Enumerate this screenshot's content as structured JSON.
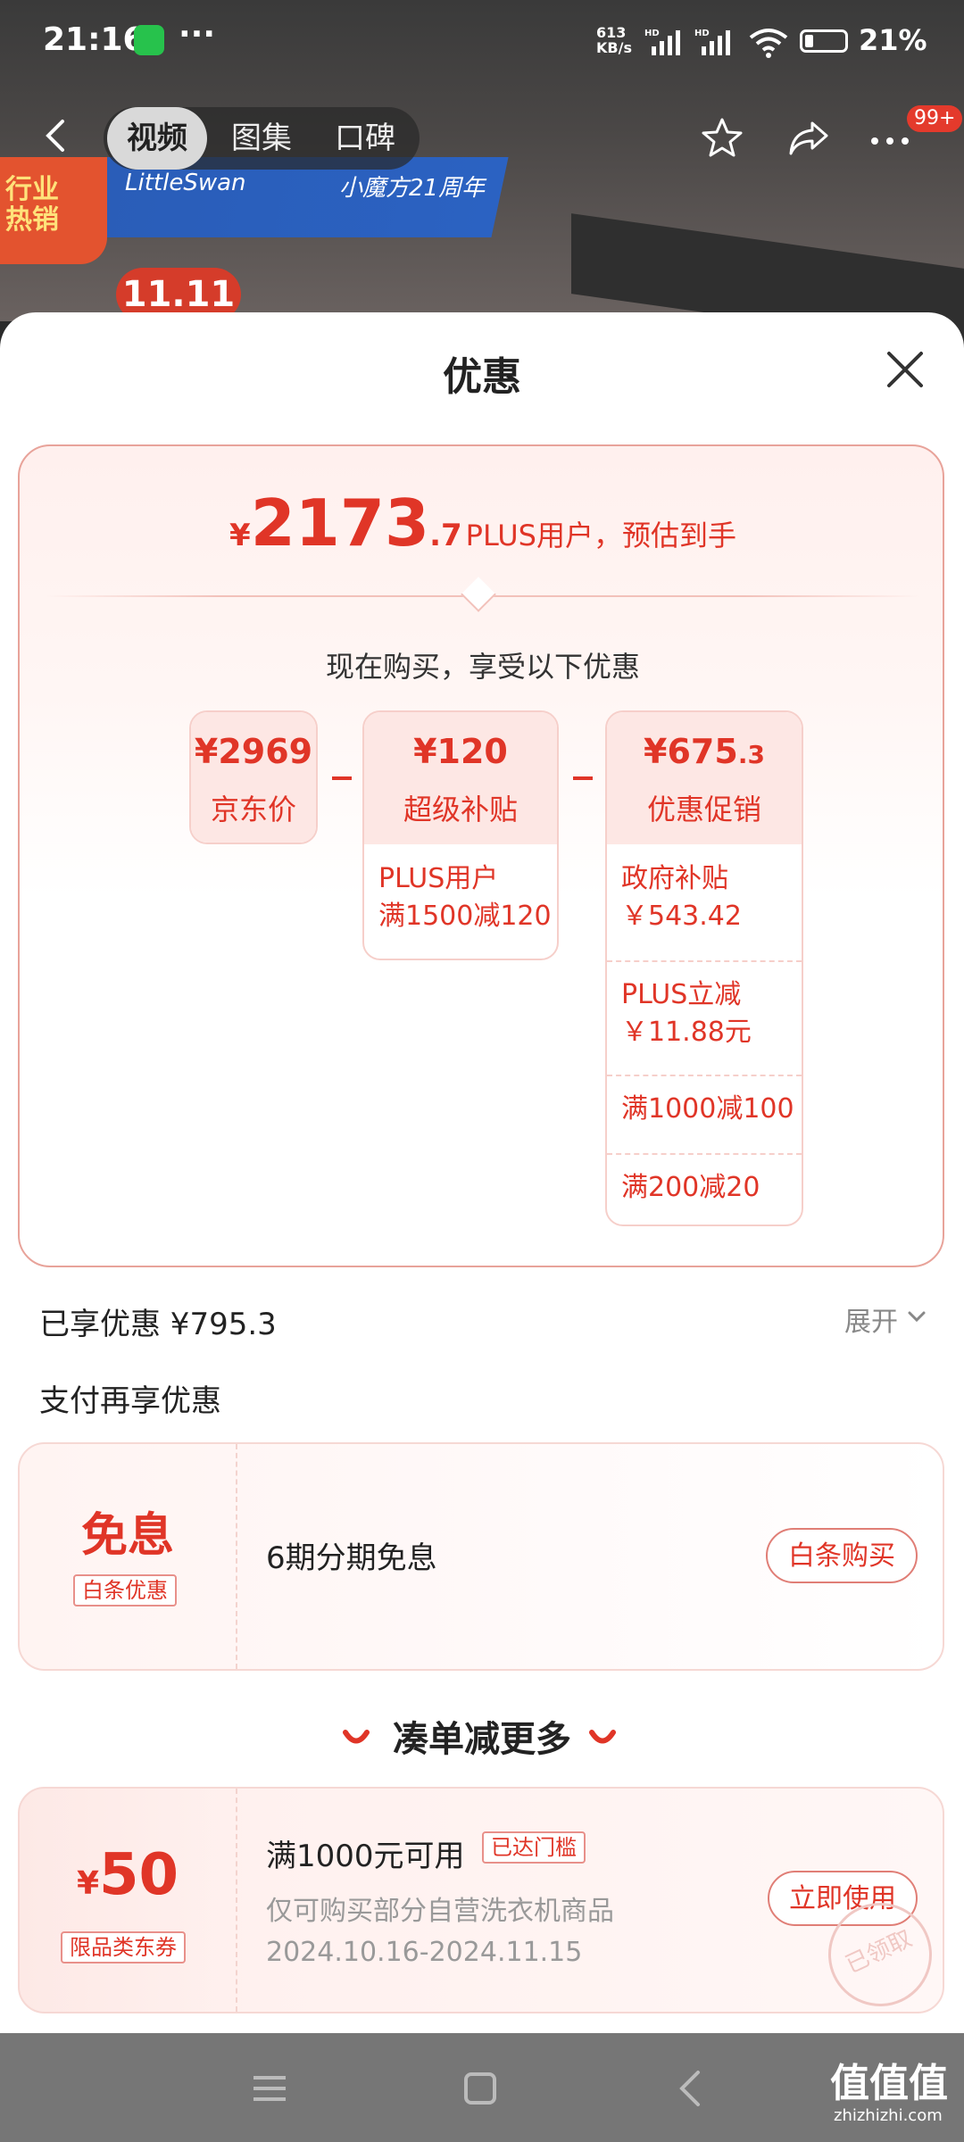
{
  "status_bar": {
    "time": "21:16",
    "net_speed_value": "613",
    "net_speed_unit": "KB/s",
    "hd1": "HD",
    "hd2": "HD",
    "battery": "21%"
  },
  "nav": {
    "tabs": [
      {
        "label": "视频"
      },
      {
        "label": "图集"
      },
      {
        "label": "口碑"
      }
    ],
    "badge": "99+"
  },
  "background": {
    "tag": "行业\n热销",
    "brand1": "LittleSwan",
    "brand2": "小魔方21周年",
    "badge": "11.11"
  },
  "sheet": {
    "title": "优惠",
    "price": {
      "yen": "¥",
      "int": "2173",
      "dec": ".7",
      "caption": "PLUS用户，预估到手"
    },
    "sub_head": "现在购买，享受以下优惠",
    "cols": [
      {
        "value": "¥2969",
        "label": "京东价",
        "items": []
      },
      {
        "value": "¥120",
        "label": "超级补贴",
        "items": [
          [
            "PLUS用户",
            "满1500减120"
          ]
        ]
      },
      {
        "value": "¥675",
        "value_dec": ".3",
        "label": "优惠促销",
        "items": [
          [
            "政府补贴",
            "￥543.42"
          ],
          [
            "PLUS立减",
            "￥11.88元"
          ],
          [
            "满1000减100"
          ],
          [
            "满200减20"
          ]
        ]
      }
    ],
    "saved": "已享优惠 ¥795.3",
    "expand": "展开",
    "pay_head": "支付再享优惠",
    "installment": {
      "big": "免息",
      "tag": "白条优惠",
      "desc": "6期分期免息",
      "button": "白条购买"
    },
    "more": "凑单减更多",
    "coupon": {
      "yen": "¥",
      "amount": "50",
      "tag": "限品类东券",
      "threshold": "满1000元可用",
      "status": "已达门槛",
      "scope": "仅可购买部分自营洗衣机商品",
      "dates": "2024.10.16-2024.11.15",
      "button": "立即使用",
      "stamp": "已领取"
    }
  },
  "watermark": {
    "text": "值值值",
    "site": "zhizhizhi.com"
  }
}
